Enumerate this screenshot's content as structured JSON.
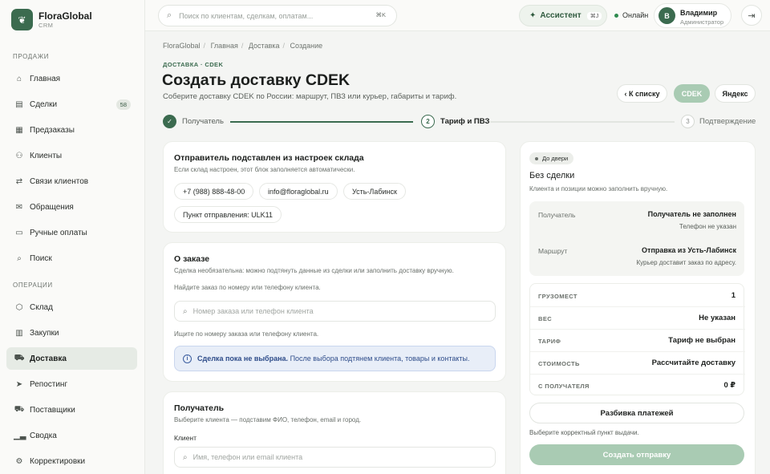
{
  "brand": {
    "name": "FloraGlobal",
    "sub": "CRM"
  },
  "sidebar": {
    "sections": [
      {
        "label": "ПРОДАЖИ"
      },
      {
        "label": "ОПЕРАЦИИ"
      }
    ],
    "items": [
      {
        "label": "Главная",
        "icon": "home-icon"
      },
      {
        "label": "Сделки",
        "icon": "deals-icon",
        "badge": "58"
      },
      {
        "label": "Предзаказы",
        "icon": "calendar-icon"
      },
      {
        "label": "Клиенты",
        "icon": "users-icon"
      },
      {
        "label": "Связи клиентов",
        "icon": "link-icon"
      },
      {
        "label": "Обращения",
        "icon": "inbox-icon"
      },
      {
        "label": "Ручные оплаты",
        "icon": "payment-icon"
      },
      {
        "label": "Поиск",
        "icon": "search-icon"
      },
      {
        "label": "Склад",
        "icon": "box-icon"
      },
      {
        "label": "Закупки",
        "icon": "receipt-icon"
      },
      {
        "label": "Доставка",
        "icon": "truck-icon",
        "active": true
      },
      {
        "label": "Репостинг",
        "icon": "send-icon"
      },
      {
        "label": "Поставщики",
        "icon": "supplier-icon"
      },
      {
        "label": "Сводка",
        "icon": "chart-icon"
      },
      {
        "label": "Корректировки",
        "icon": "adjust-icon"
      }
    ]
  },
  "topbar": {
    "search_placeholder": "Поиск по клиентам, сделкам, оплатам...",
    "search_kbd": "⌘K",
    "assistant_label": "Ассистент",
    "assistant_kbd": "⌘J",
    "status": "Онлайн",
    "user": {
      "initial": "В",
      "name": "Владимир",
      "role": "Администратор"
    }
  },
  "header": {
    "breadcrumbs": [
      "FloraGlobal",
      "Главная",
      "Доставка",
      "Создание"
    ],
    "eyebrow": "ДОСТАВКА · CDEK",
    "title": "Создать доставку CDEK",
    "subtitle": "Соберите доставку CDEK по России: маршрут, ПВЗ или курьер, габариты и тариф.",
    "back_label": "‹ К списку",
    "cdek_label": "CDEK",
    "yandex_label": "Яндекс"
  },
  "stepper": [
    {
      "num": "✓",
      "label": "Получатель",
      "state": "done"
    },
    {
      "num": "2",
      "label": "Тариф и ПВЗ",
      "state": "active"
    },
    {
      "num": "3",
      "label": "Подтверждение",
      "state": "todo"
    }
  ],
  "sender": {
    "title": "Отправитель подставлен из настроек склада",
    "subtitle": "Если склад настроен, этот блок заполняется автоматически.",
    "chips": [
      "+7 (988) 888-48-00",
      "info@floraglobal.ru",
      "Усть-Лабинск",
      "Пункт отправления: ULK11"
    ]
  },
  "order": {
    "title": "О заказе",
    "subtitle": "Сделка необязательна: можно подтянуть данные из сделки или заполнить доставку вручную.",
    "find_label": "Найдите заказ по номеру или телефону клиента.",
    "search_placeholder": "Номер заказа или телефон клиента",
    "search_hint": "Ищите по номеру заказа или телефону клиента.",
    "info_bold": "Сделка пока не выбрана.",
    "info_text": " После выбора подтянем клиента, товары и контакты."
  },
  "recipient": {
    "title": "Получатель",
    "subtitle": "Выберите клиента — подставим ФИО, телефон, email и город.",
    "client_label": "Клиент",
    "client_placeholder": "Имя, телефон или email клиента"
  },
  "summary": {
    "tag": "До двери",
    "deal_title": "Без сделки",
    "deal_sub": "Клиента и позиции можно заполнить вручную.",
    "recipient_label": "Получатель",
    "recipient_value": "Получатель не заполнен",
    "recipient_sub": "Телефон не указан",
    "route_label": "Маршрут",
    "route_value": "Отправка из Усть-Лабинск",
    "route_sub": "Курьер доставит заказ по адресу.",
    "metrics": [
      {
        "label": "ГРУЗОМЕСТ",
        "value": "1"
      },
      {
        "label": "ВЕС",
        "value": "Не указан"
      },
      {
        "label": "ТАРИФ",
        "value": "Тариф не выбран"
      },
      {
        "label": "СТОИМОСТЬ",
        "value": "Рассчитайте доставку"
      },
      {
        "label": "С ПОЛУЧАТЕЛЯ",
        "value": "0 ₽"
      }
    ],
    "payments_label": "Разбивка платежей",
    "hint": "Выберите корректный пункт выдачи.",
    "create_label": "Создать отправку"
  },
  "colors": {
    "accent": "#3b6b4f",
    "accent_light": "#a9cbb3",
    "info_bg": "#e8eef8",
    "info_text": "#2f4d8a"
  }
}
